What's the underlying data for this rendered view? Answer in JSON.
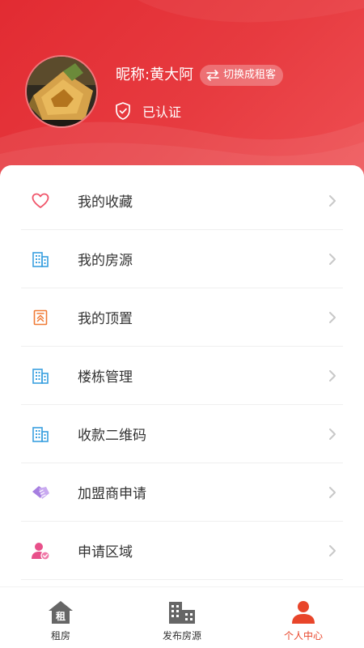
{
  "header": {
    "nickname": "昵称:黄大阿",
    "switch_label": "切换成租客",
    "verified_label": "已认证"
  },
  "menu": {
    "items": [
      {
        "label": "我的收藏",
        "icon": "heart-icon"
      },
      {
        "label": "我的房源",
        "icon": "building-icon"
      },
      {
        "label": "我的顶置",
        "icon": "pin-top-icon"
      },
      {
        "label": "楼栋管理",
        "icon": "building-icon"
      },
      {
        "label": "收款二维码",
        "icon": "building-icon"
      },
      {
        "label": "加盟商申请",
        "icon": "handshake-icon"
      },
      {
        "label": "申请区域",
        "icon": "user-check-icon"
      }
    ]
  },
  "tabbar": {
    "tabs": [
      {
        "label": "租房",
        "icon": "house-rent-icon",
        "active": false
      },
      {
        "label": "发布房源",
        "icon": "buildings-icon",
        "active": false
      },
      {
        "label": "个人中心",
        "icon": "person-icon",
        "active": true
      }
    ]
  },
  "colors": {
    "header_red": "#e22b32",
    "accent_orange": "#e8452a",
    "icon_blue": "#3aa0e0",
    "icon_pink": "#f0556a",
    "icon_purple": "#a67ee0"
  }
}
